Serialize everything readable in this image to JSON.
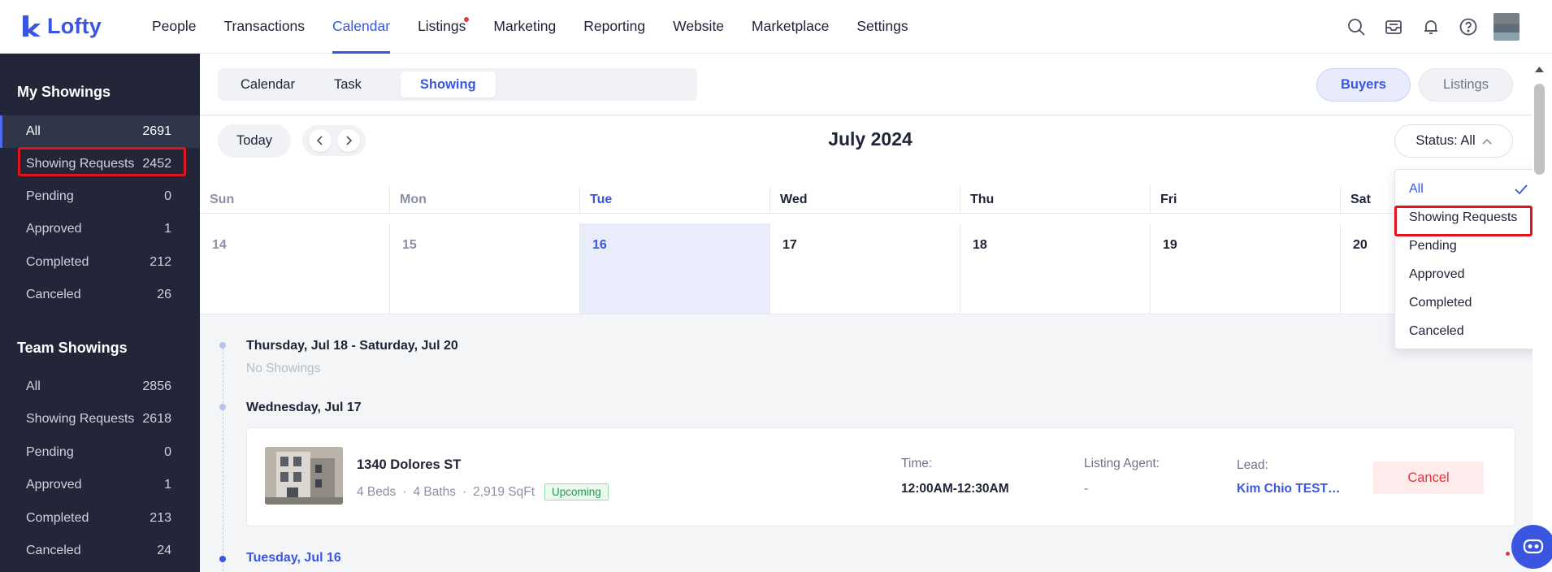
{
  "app": {
    "name": "Lofty"
  },
  "nav": {
    "items": [
      {
        "label": "People",
        "active": false
      },
      {
        "label": "Transactions",
        "active": false
      },
      {
        "label": "Calendar",
        "active": true
      },
      {
        "label": "Listings",
        "active": false,
        "dot": true
      },
      {
        "label": "Marketing",
        "active": false
      },
      {
        "label": "Reporting",
        "active": false
      },
      {
        "label": "Website",
        "active": false
      },
      {
        "label": "Marketplace",
        "active": false
      },
      {
        "label": "Settings",
        "active": false
      }
    ]
  },
  "sidebar": {
    "my_title": "My Showings",
    "my_items": [
      {
        "label": "All",
        "count": "2691"
      },
      {
        "label": "Showing Requests",
        "count": "2452"
      },
      {
        "label": "Pending",
        "count": "0"
      },
      {
        "label": "Approved",
        "count": "1"
      },
      {
        "label": "Completed",
        "count": "212"
      },
      {
        "label": "Canceled",
        "count": "26"
      }
    ],
    "team_title": "Team Showings",
    "team_items": [
      {
        "label": "All",
        "count": "2856"
      },
      {
        "label": "Showing Requests",
        "count": "2618"
      },
      {
        "label": "Pending",
        "count": "0"
      },
      {
        "label": "Approved",
        "count": "1"
      },
      {
        "label": "Completed",
        "count": "213"
      },
      {
        "label": "Canceled",
        "count": "24"
      }
    ]
  },
  "tabs": {
    "calendar": "Calendar",
    "task": "Task",
    "showing": "Showing"
  },
  "toggle": {
    "buyers": "Buyers",
    "listings": "Listings"
  },
  "calendar": {
    "today": "Today",
    "month": "July 2024",
    "status_label": "Status: All",
    "weekdays": [
      "Sun",
      "Mon",
      "Tue",
      "Wed",
      "Thu",
      "Fri",
      "Sat"
    ],
    "days": [
      "14",
      "15",
      "16",
      "17",
      "18",
      "19",
      "20"
    ]
  },
  "status_dropdown": {
    "options": [
      "All",
      "Showing Requests",
      "Pending",
      "Approved",
      "Completed",
      "Canceled"
    ],
    "selected": "All"
  },
  "timeline": {
    "group1_title": "Thursday, Jul 18 - Saturday, Jul 20",
    "group1_empty": "No Showings",
    "group2_title": "Wednesday, Jul 17",
    "group3_title": "Tuesday, Jul 16",
    "card": {
      "address": "1340 Dolores ST",
      "beds": "4 Beds",
      "baths": "4 Baths",
      "sqft": "2,919 SqFt",
      "badge": "Upcoming",
      "time_label": "Time:",
      "time_value": "12:00AM-12:30AM",
      "agent_label": "Listing Agent:",
      "agent_value": "-",
      "lead_label": "Lead:",
      "lead_value": "Kim Chio TEST ...",
      "cancel": "Cancel"
    }
  }
}
